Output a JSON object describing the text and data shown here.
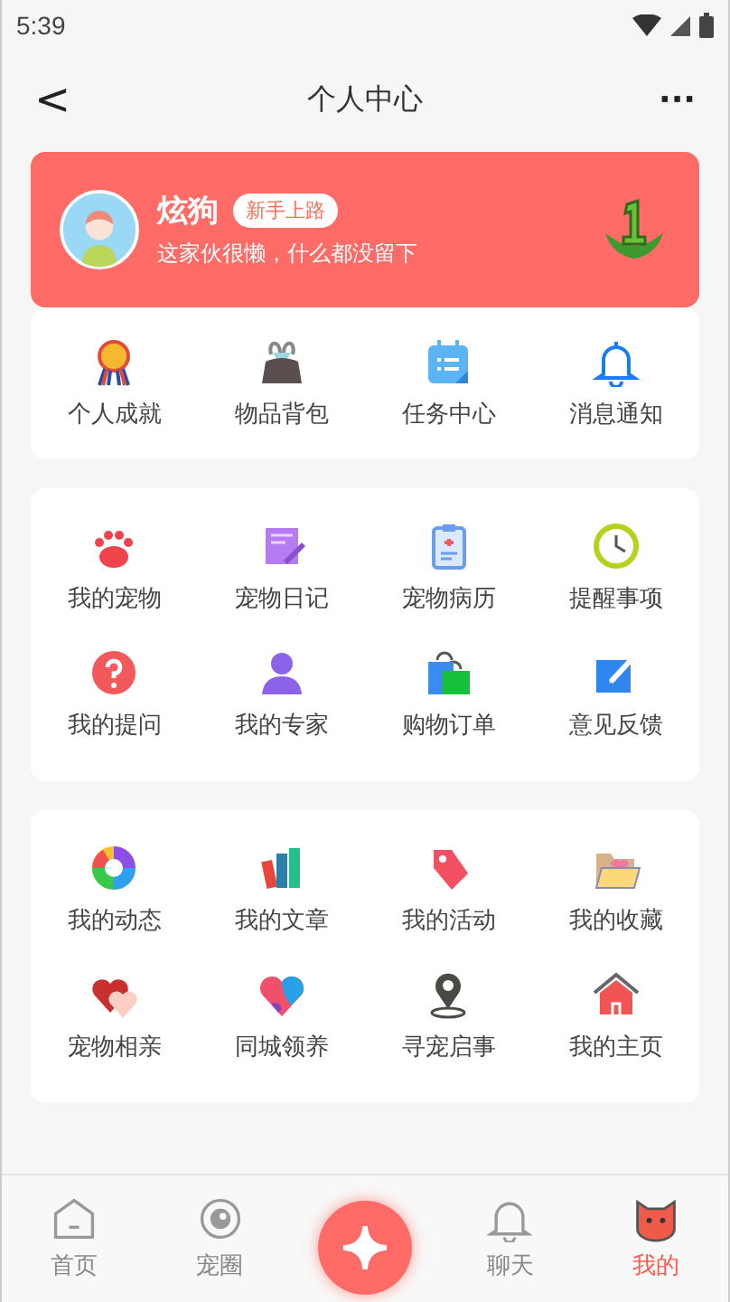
{
  "status_bar": {
    "time": "5:39"
  },
  "nav": {
    "back": "<",
    "title": "个人中心",
    "more": "···"
  },
  "profile": {
    "name": "炫狗",
    "badge": "新手上路",
    "bio": "这家伙很懒，什么都没留下"
  },
  "quick": [
    {
      "label": "个人成就"
    },
    {
      "label": "物品背包"
    },
    {
      "label": "任务中心"
    },
    {
      "label": "消息通知"
    }
  ],
  "grids": [
    [
      {
        "label": "我的宠物"
      },
      {
        "label": "宠物日记"
      },
      {
        "label": "宠物病历"
      },
      {
        "label": "提醒事项"
      },
      {
        "label": "我的提问"
      },
      {
        "label": "我的专家"
      },
      {
        "label": "购物订单"
      },
      {
        "label": "意见反馈"
      }
    ],
    [
      {
        "label": "我的动态"
      },
      {
        "label": "我的文章"
      },
      {
        "label": "我的活动"
      },
      {
        "label": "我的收藏"
      },
      {
        "label": "宠物相亲"
      },
      {
        "label": "同城领养"
      },
      {
        "label": "寻宠启事"
      },
      {
        "label": "我的主页"
      }
    ]
  ],
  "tabbar": [
    {
      "kind": "tab",
      "label": "首页",
      "selected": false
    },
    {
      "kind": "tab",
      "label": "宠圈",
      "selected": false
    },
    {
      "kind": "add"
    },
    {
      "kind": "tab",
      "label": "聊天",
      "selected": false
    },
    {
      "kind": "tab",
      "label": "我的",
      "selected": true
    }
  ]
}
